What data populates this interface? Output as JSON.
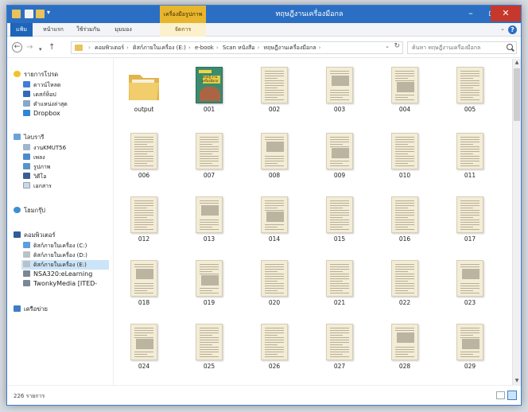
{
  "window": {
    "title": "ทฤษฎีงานเครื่องมือกล",
    "context_tab": "เครื่องมือรูปภาพ",
    "colors": {
      "accent": "#2b6fc4",
      "context": "#e8b62e",
      "close": "#c7382c"
    }
  },
  "ribbon": {
    "tabs": [
      "แฟ้ม",
      "หน้าแรก",
      "ใช้ร่วมกัน",
      "มุมมอง"
    ],
    "context_tab": "จัดการ"
  },
  "address": {
    "breadcrumb": [
      "คอมพิวเตอร์",
      "ดิสก์ภายในเครื่อง (E:)",
      "e-book",
      "Scan หนังสือ",
      "ทฤษฎีงานเครื่องมือกล"
    ],
    "search_placeholder": "ค้นหา ทฤษฎีงานเครื่องมือกล"
  },
  "sidebar": {
    "favorites": {
      "label": "รายการโปรด",
      "items": [
        "ดาวน์โหลด",
        "เดสก์ท็อป",
        "ตำแหน่งล่าสุด",
        "Dropbox"
      ]
    },
    "libraries": {
      "label": "ไลบรารี",
      "items": [
        "งานKMUT56",
        "เพลง",
        "รูปภาพ",
        "วิดีโอ",
        "เอกสาร"
      ]
    },
    "homegroup": {
      "label": "โฮมกรุ๊ป"
    },
    "computer": {
      "label": "คอมพิวเตอร์",
      "items": [
        "ดิสก์ภายในเครื่อง (C:)",
        "ดิสก์ภายในเครื่อง (D:)",
        "ดิสก์ภายในเครื่อง (E:)",
        "NSA320:eLearning",
        "TwonkyMedia [ITED-"
      ]
    },
    "network": {
      "label": "เครือข่าย"
    }
  },
  "files": [
    "output",
    "001",
    "002",
    "003",
    "004",
    "005",
    "006",
    "007",
    "008",
    "009",
    "010",
    "011",
    "012",
    "013",
    "014",
    "015",
    "016",
    "017",
    "018",
    "019",
    "020",
    "021",
    "022",
    "023",
    "024",
    "025",
    "026",
    "027",
    "028",
    "029"
  ],
  "cover_title": "ทฤษฎี งาน เครื่องมือกล",
  "status": {
    "item_count": "226 รายการ"
  }
}
